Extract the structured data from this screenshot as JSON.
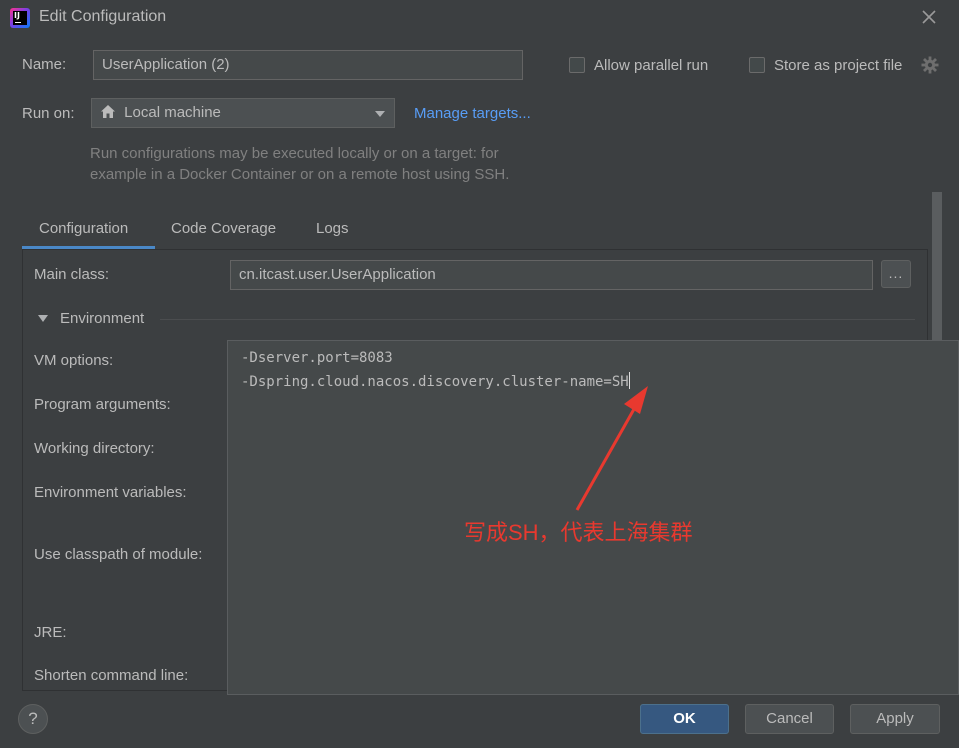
{
  "window": {
    "title": "Edit Configuration",
    "app_icon_text": "IJ"
  },
  "name_row": {
    "label": "Name:",
    "value": "UserApplication (2)",
    "allow_parallel_label": "Allow parallel run",
    "store_project_label": "Store as project file"
  },
  "run_on": {
    "label": "Run on:",
    "selected": "Local machine",
    "manage_link": "Manage targets...",
    "hint_line1": "Run configurations may be executed locally or on a target: for",
    "hint_line2": "example in a Docker Container or on a remote host using SSH."
  },
  "tabs": [
    {
      "label": "Configuration",
      "active": true
    },
    {
      "label": "Code Coverage",
      "active": false
    },
    {
      "label": "Logs",
      "active": false
    }
  ],
  "config": {
    "main_class_label": "Main class:",
    "main_class_value": "cn.itcast.user.UserApplication",
    "browse_label": "...",
    "environment_label": "Environment",
    "vm_options_label": "VM options:",
    "program_args_label": "Program arguments:",
    "working_dir_label": "Working directory:",
    "env_vars_label": "Environment variables:",
    "classpath_label": "Use classpath of module:",
    "jre_label": "JRE:",
    "shorten_label": "Shorten command line:"
  },
  "vm_editor": {
    "line1": "-Dserver.port=8083",
    "line2": "-Dspring.cloud.nacos.discovery.cluster-name=SH"
  },
  "annotation": {
    "text": "写成SH，代表上海集群",
    "color": "#e8392f"
  },
  "footer": {
    "help_label": "?",
    "ok_label": "OK",
    "cancel_label": "Cancel",
    "apply_label": "Apply"
  },
  "icons": {
    "close": "close-icon",
    "home": "home-icon",
    "gear": "gear-icon",
    "collapse": "triangle-down-icon"
  }
}
